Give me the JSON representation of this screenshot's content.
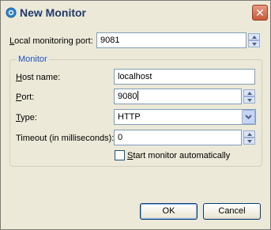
{
  "window": {
    "title": "New Monitor",
    "close_glyph": "✕"
  },
  "form": {
    "local_port_label": "Local monitoring port:",
    "local_port_value": "9081",
    "group_title": "Monitor",
    "host_label": "Host name:",
    "host_value": "localhost",
    "port_label": "Port:",
    "port_value": "9080",
    "type_label": "Type:",
    "type_value": "HTTP",
    "timeout_label": "Timeout (in milliseconds):",
    "timeout_value": "0",
    "autostart_label": "Start monitor automatically",
    "autostart_checked": false
  },
  "buttons": {
    "ok": "OK",
    "cancel": "Cancel"
  },
  "icons": {
    "title": "monitor-icon",
    "close": "close-icon",
    "spinner_up": "arrow-up-icon",
    "spinner_down": "arrow-down-icon",
    "combo": "chevron-down-icon"
  },
  "colors": {
    "title_text": "#1f3a6b",
    "group_title": "#2050c0",
    "close_button": "#c75a39"
  }
}
